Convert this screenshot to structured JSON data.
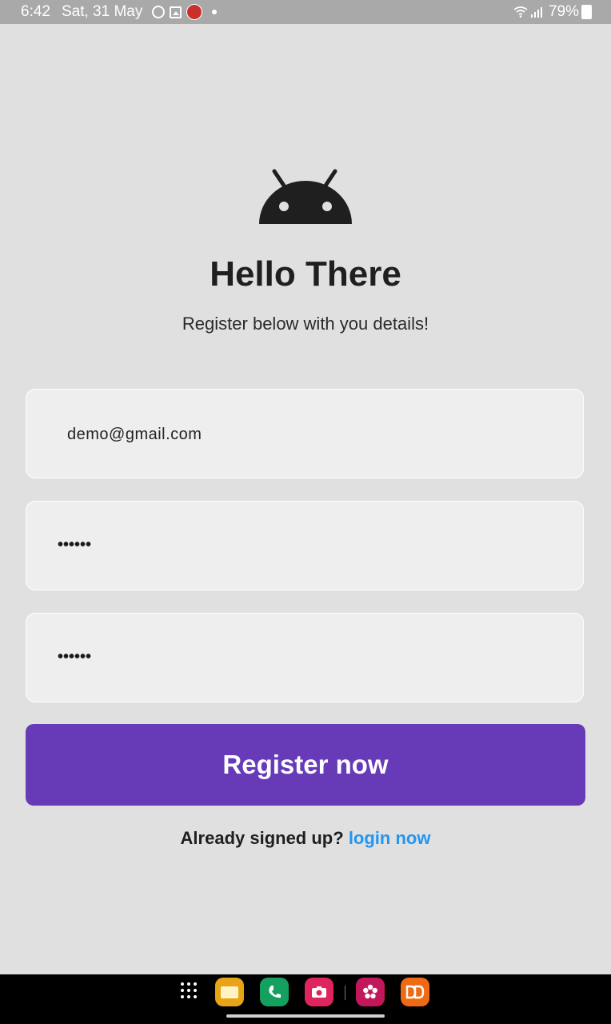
{
  "status_bar": {
    "time": "6:42",
    "date": "Sat, 31 May",
    "battery": "79%",
    "icons": [
      "whatsapp-icon",
      "gallery-icon",
      "app-notification-icon",
      "more-dot-icon",
      "wifi-icon",
      "signal-icon",
      "battery-icon"
    ]
  },
  "header": {
    "logo_icon": "android-icon",
    "title": "Hello There",
    "subtitle": "Register below with you details!"
  },
  "form": {
    "email_value": "demo@gmail.com",
    "password_masked": "••••••",
    "confirm_password_masked": "••••••",
    "register_label": "Register now"
  },
  "footer": {
    "prompt": "Already signed up?",
    "login_label": "login now"
  },
  "nav_bar": {
    "dock": [
      "apps-grid-icon",
      "notes-app-icon",
      "phone-app-icon",
      "camera-app-icon",
      "flower-app-icon",
      "dd-app-icon"
    ]
  },
  "colors": {
    "background": "#e0e0e0",
    "status_bar": "#a9a9a9",
    "accent": "#673ab7",
    "link": "#2196f3",
    "field_bg": "#eeeeee"
  }
}
